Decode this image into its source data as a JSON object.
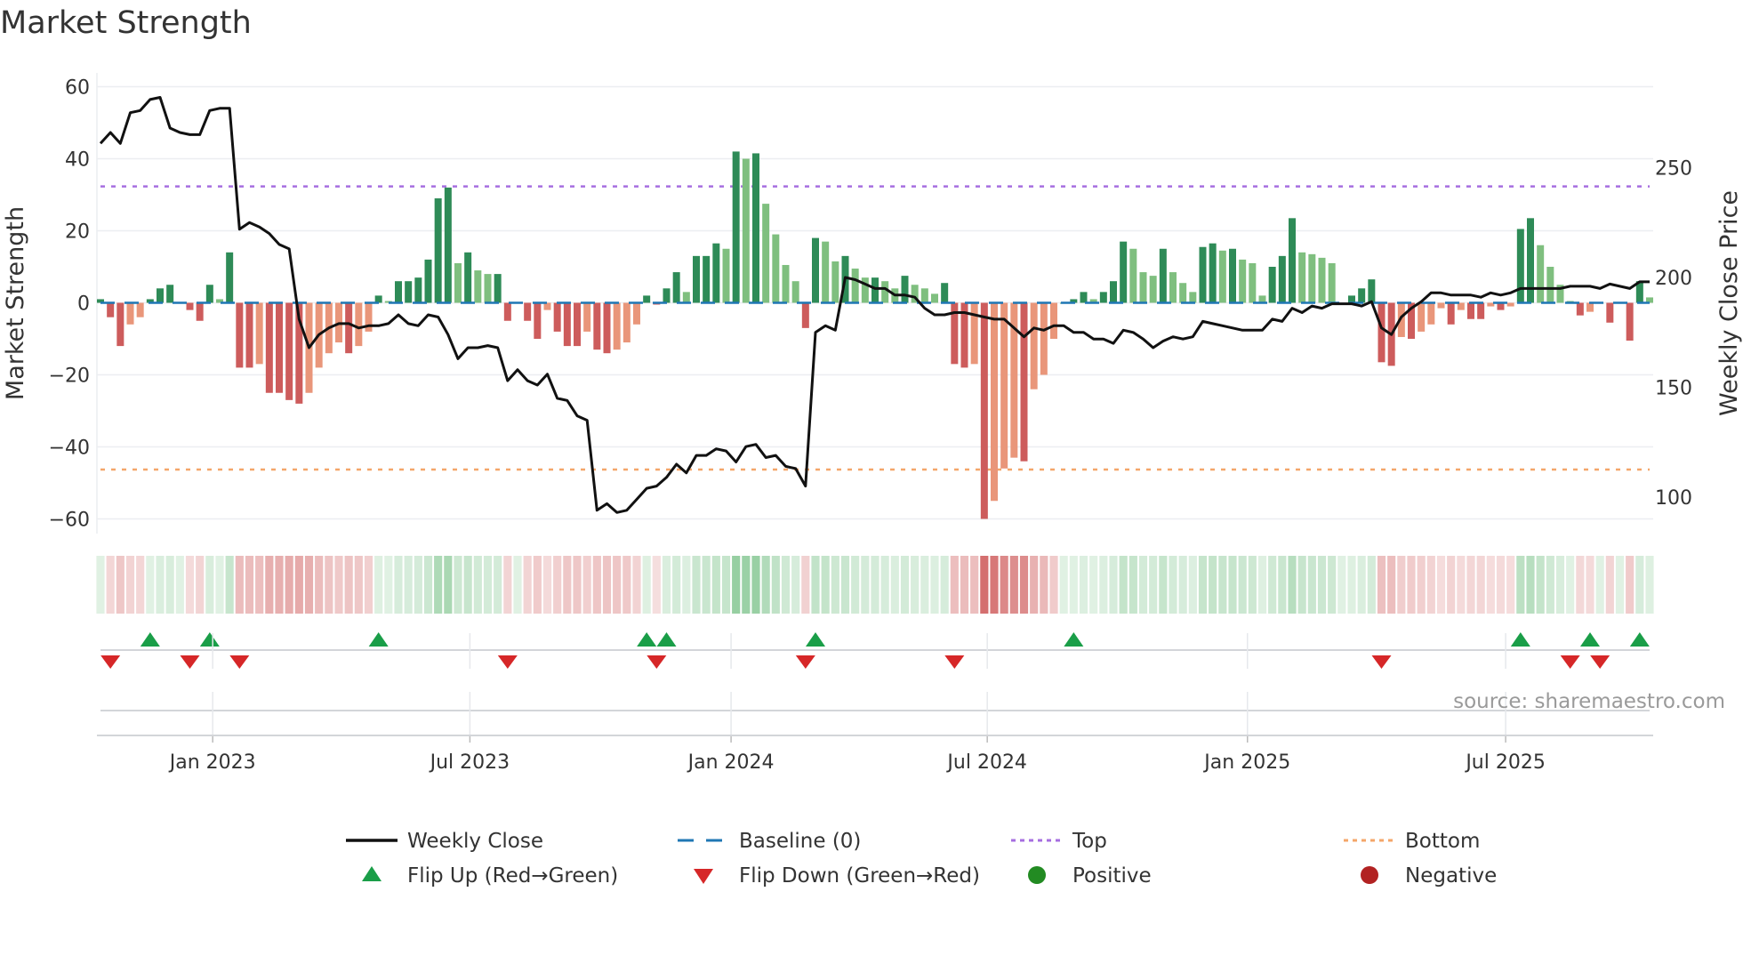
{
  "chart_data": {
    "type": "bar",
    "title": "Market Strength",
    "ylabel": "Market Strength",
    "y2label": "Weekly Close Price",
    "ylim": [
      -65,
      65
    ],
    "y2lim": [
      82.8,
      292
    ],
    "yticks": [
      60,
      40,
      20,
      0,
      -20,
      -40,
      -60
    ],
    "yticklabels": [
      "60",
      "40",
      "20",
      "0",
      "−20",
      "−40",
      "−60"
    ],
    "y2ticks": [
      100,
      150,
      200,
      250
    ],
    "y2ticklabels": [
      "100",
      "150",
      "200",
      "250"
    ],
    "xticks": [
      {
        "label": "Jan 2023",
        "week": 11.3
      },
      {
        "label": "Jul 2023",
        "week": 37.2
      },
      {
        "label": "Jan 2024",
        "week": 63.5
      },
      {
        "label": "Jul 2024",
        "week": 89.3
      },
      {
        "label": "Jan 2025",
        "week": 115.5
      },
      {
        "label": "Jul 2025",
        "week": 141.5
      }
    ],
    "top_level": 32.3,
    "bottom_level": -46.3,
    "baseline": 0,
    "strength": [
      1,
      -4,
      -12,
      -6,
      -4,
      1,
      4,
      5,
      0,
      -2,
      -5,
      5,
      1,
      14,
      -18,
      -18,
      -17,
      -25,
      -25,
      -27,
      -28,
      -25,
      -18,
      -14,
      -11,
      -14,
      -12,
      -8,
      2,
      0.5,
      6,
      6,
      7,
      12,
      29,
      32,
      11,
      14,
      9,
      8,
      8,
      -5,
      0,
      -5,
      -10,
      -2,
      -8,
      -12,
      -12,
      -8,
      -13,
      -14,
      -13,
      -11,
      -6,
      2,
      -0.5,
      4,
      8.5,
      3,
      13,
      13,
      16.5,
      15,
      42,
      40,
      41.5,
      27.5,
      19,
      10.5,
      6,
      -7,
      18,
      17,
      11.5,
      13,
      9.5,
      7,
      7,
      6,
      4,
      7.5,
      5,
      4,
      2.5,
      5.5,
      -17,
      -18,
      -17,
      -60,
      -55,
      -46,
      -43,
      -44,
      -24,
      -20,
      -10,
      0,
      1,
      3,
      1,
      3,
      6,
      17,
      15,
      8.5,
      7.5,
      15,
      8.5,
      5.5,
      3,
      15.5,
      16.5,
      14.5,
      15,
      12,
      11,
      2,
      10,
      13,
      23.5,
      14,
      13.5,
      12.5,
      11,
      0,
      2,
      4,
      6.5,
      -16.5,
      -17.5,
      -9.5,
      -10,
      -8,
      -6,
      -1.5,
      -6,
      -2,
      -4.5,
      -4.5,
      -1,
      -2,
      -1,
      20.5,
      23.5,
      16,
      10,
      5,
      0.5,
      -3.5,
      -2.5,
      0,
      -5.5,
      0,
      -10.5,
      6,
      1.5
    ],
    "weekly_close": [
      261,
      266,
      261,
      275,
      276,
      281,
      282,
      268,
      266,
      265,
      265,
      276,
      277,
      277,
      222,
      225,
      223,
      220,
      215,
      213,
      181,
      168,
      174,
      177,
      179,
      179,
      177,
      178,
      178,
      179,
      183,
      179,
      178,
      183,
      182,
      174,
      163,
      168,
      168,
      169,
      168,
      153,
      158,
      153,
      151,
      156,
      145,
      144,
      137,
      135,
      94,
      97,
      93,
      94,
      99,
      104,
      105,
      109,
      115,
      111,
      119,
      119,
      122,
      121,
      116,
      123,
      124,
      118,
      119,
      114,
      113,
      105,
      175,
      178,
      176,
      200,
      199,
      197,
      195,
      195,
      192,
      192,
      191,
      186,
      183,
      183,
      184,
      184,
      183,
      182,
      181,
      181,
      177,
      173,
      177,
      176,
      178,
      178,
      175,
      175,
      172,
      172,
      170,
      176,
      175,
      172,
      168,
      171,
      173,
      172,
      173,
      180,
      179,
      178,
      177,
      176,
      176,
      176,
      181,
      180,
      186,
      184,
      187,
      186,
      188,
      188,
      188,
      187,
      189,
      177,
      174,
      182,
      186,
      189,
      193,
      193,
      192,
      192,
      192,
      191,
      193,
      192,
      193,
      195,
      195,
      195,
      195,
      195,
      196,
      196,
      196,
      195,
      197,
      196,
      195,
      198,
      198
    ],
    "flip_up_weeks": [
      5,
      11,
      28,
      55,
      57,
      72,
      98,
      143,
      150,
      155
    ],
    "flip_down_weeks": [
      1,
      9,
      14,
      41,
      56,
      71,
      86,
      129,
      148,
      151
    ],
    "legend": {
      "placement": "bottom",
      "items": [
        {
          "label": "Weekly Close",
          "kind": "line"
        },
        {
          "label": "Baseline (0)",
          "kind": "dash"
        },
        {
          "label": "Top",
          "kind": "dot-purple"
        },
        {
          "label": "Bottom",
          "kind": "dot-orange"
        },
        {
          "label": "Flip Up (Red→Green)",
          "kind": "tri-up"
        },
        {
          "label": "Flip Down (Green→Red)",
          "kind": "tri-down"
        },
        {
          "label": "Positive",
          "kind": "circle-green"
        },
        {
          "label": "Negative",
          "kind": "circle-red"
        }
      ]
    },
    "source": "source: sharemaestro.com",
    "grid": true
  },
  "colors": {
    "pos_strong": "#2e8b57",
    "pos_weak": "#7fbf7f",
    "neg_strong": "#cd5c5c",
    "neg_weak": "#e9967a",
    "baseline": "#1f77b4",
    "top": "#a66ee0",
    "bottom": "#f4a66a",
    "line": "#111111",
    "flip_up": "#1a9e48",
    "flip_down": "#d62728",
    "positive": "#228b22",
    "negative": "#b22222"
  }
}
